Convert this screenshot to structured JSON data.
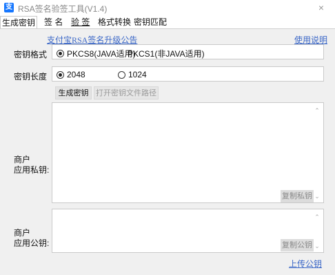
{
  "window": {
    "icon_glyph": "支",
    "title": "RSA签名验签工具(V1.4)",
    "close_glyph": "×"
  },
  "tabs": [
    {
      "label": "生成密钥"
    },
    {
      "label": "签 名"
    },
    {
      "label": "验 签"
    },
    {
      "label": "格式转换"
    },
    {
      "label": "密钥匹配"
    }
  ],
  "links": {
    "announcement": "支付宝RSA签名升级公告",
    "help": "使用说明",
    "upload_public_key": "上传公钥"
  },
  "key_format": {
    "label": "密钥格式",
    "options": [
      "PKCS8(JAVA适用)",
      "PKCS1(非JAVA适用)"
    ],
    "selected": "PKCS8(JAVA适用)"
  },
  "key_length": {
    "label": "密钥长度",
    "options": [
      "2048",
      "1024"
    ],
    "selected": "2048"
  },
  "buttons": {
    "generate": "生成密钥",
    "open_path": "打开密钥文件路径"
  },
  "private_key": {
    "label_line1": "商户",
    "label_line2": "应用私钥:",
    "value": "",
    "copy_label": "复制私钥"
  },
  "public_key": {
    "label_line1": "商户",
    "label_line2": "应用公钥:",
    "value": "",
    "copy_label": "复制公钥"
  },
  "colors": {
    "accent": "#1677ff",
    "link": "#3b67c7",
    "panel_bg": "#f0f0f0"
  },
  "icons": {
    "app": "alipay-icon",
    "close": "close-icon",
    "scroll_up": "chevron-up-icon",
    "scroll_down": "chevron-down-icon"
  }
}
